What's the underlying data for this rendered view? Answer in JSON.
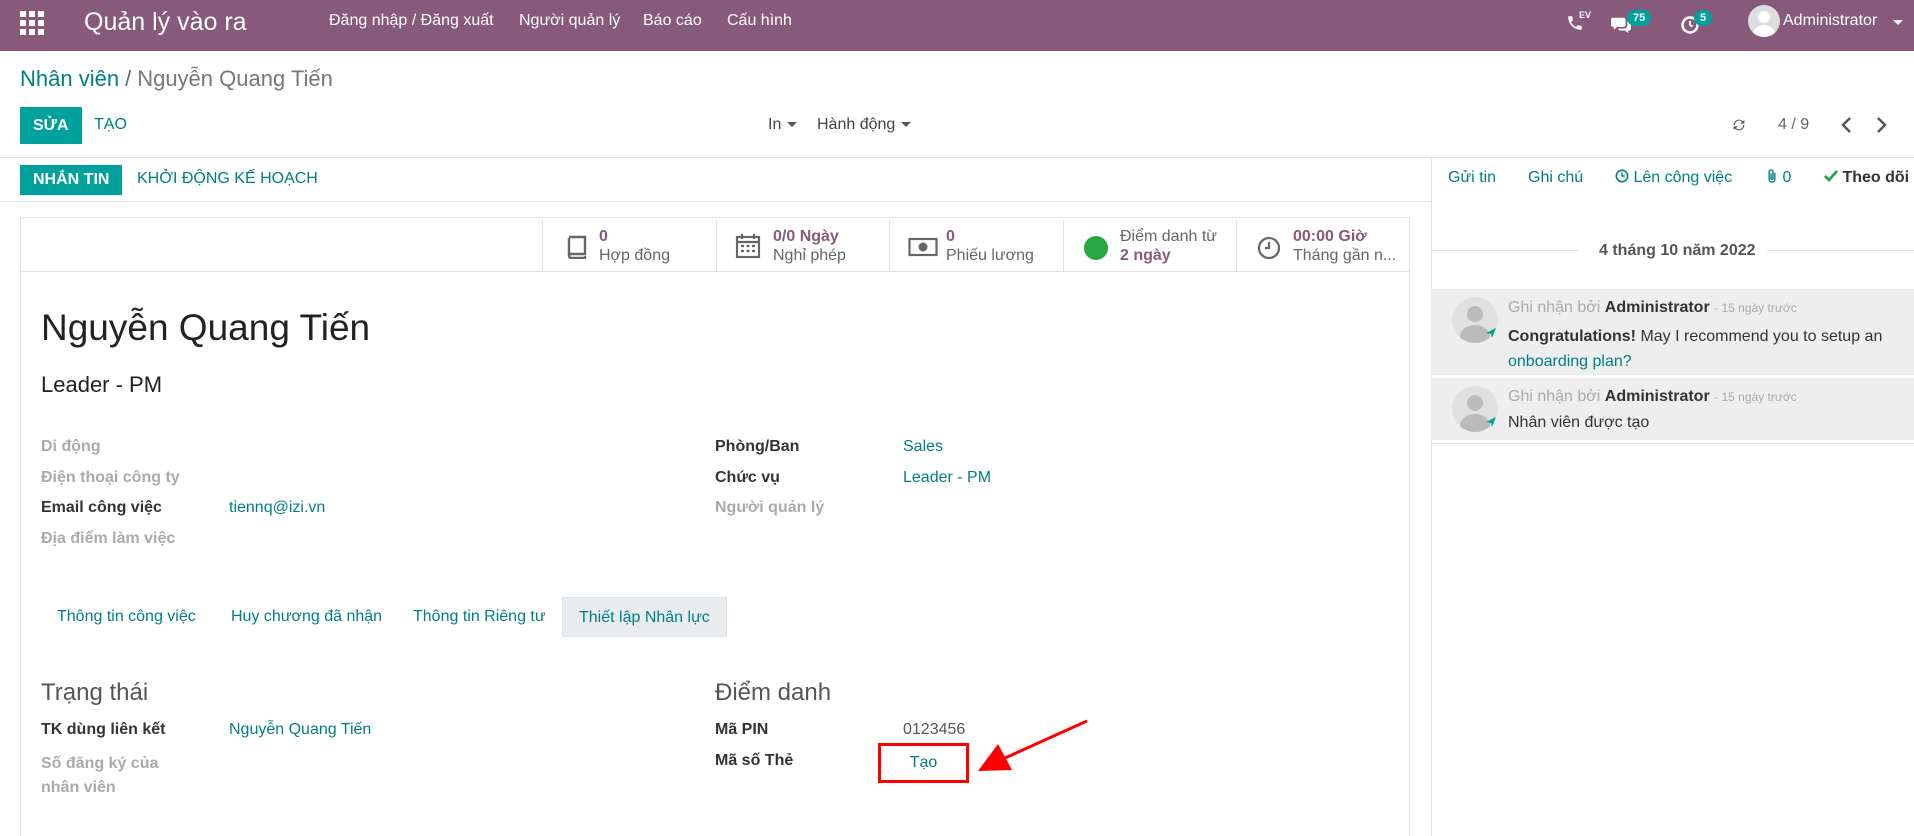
{
  "navbar": {
    "app_title": "Quản lý vào ra",
    "menu": [
      "Đăng nhập / Đăng xuất",
      "Người quản lý",
      "Báo cáo",
      "Cấu hình"
    ],
    "phone_label": "EV",
    "messages_count": "75",
    "activities_count": "5",
    "user": "Administrator"
  },
  "breadcrumb": {
    "parent": "Nhân viên",
    "separator": "/",
    "current": "Nguyễn Quang Tiến"
  },
  "toolbar": {
    "edit_label": "SỬA",
    "create_label": "TẠO",
    "print_label": "In",
    "action_label": "Hành động",
    "pager": "4 / 9"
  },
  "statusbar": {
    "send_message_label": "NHẮN TIN",
    "launch_plan_label": "KHỞI ĐỘNG KẾ HOẠCH"
  },
  "stat_buttons": [
    {
      "icon": "book-icon",
      "value": "0",
      "label": "Hợp đồng"
    },
    {
      "icon": "calendar-icon",
      "value": "0/0 Ngày",
      "label": "Nghỉ phép"
    },
    {
      "icon": "money-icon",
      "value": "0",
      "label": "Phiếu lương"
    },
    {
      "icon": "presence-dot-icon",
      "value": "2 ngày",
      "label": "Điểm danh từ"
    },
    {
      "icon": "clock-icon",
      "value": "00:00 Giờ",
      "label": "Tháng gần n..."
    }
  ],
  "employee": {
    "name": "Nguyễn Quang Tiến",
    "job_title": "Leader - PM"
  },
  "fields_left": [
    {
      "label": "Di động",
      "value": "",
      "required": false
    },
    {
      "label": "Điện thoại công ty",
      "value": "",
      "required": false
    },
    {
      "label": "Email công việc",
      "value": "tiennq@izi.vn",
      "required": true
    },
    {
      "label": "Địa điểm làm việc",
      "value": "",
      "required": false
    }
  ],
  "fields_right": [
    {
      "label": "Phòng/Ban",
      "value": "Sales",
      "required": true
    },
    {
      "label": "Chức vụ",
      "value": "Leader - PM",
      "required": true
    },
    {
      "label": "Người quản lý",
      "value": "",
      "required": false
    }
  ],
  "tabs": [
    "Thông tin công việc",
    "Huy chương đã nhận",
    "Thông tin Riêng tư",
    "Thiết lập Nhân lực"
  ],
  "status_section": {
    "title": "Trạng thái",
    "linked_user_label": "TK dùng liên kết",
    "linked_user_value": "Nguyễn Quang Tiến",
    "reg_number_label": "Số đăng ký của nhân viên"
  },
  "attendance_section": {
    "title": "Điểm danh",
    "pin_label": "Mã PIN",
    "pin_value": "0123456",
    "badge_label": "Mã số Thẻ",
    "badge_button": "Tạo"
  },
  "chatter": {
    "send_message": "Gửi tin",
    "log_note": "Ghi chú",
    "schedule_activity": "Lên công việc",
    "attachments_count": "0",
    "follow": "Theo dõi",
    "date_separator": "4 tháng 10 năm 2022",
    "messages": [
      {
        "prefix": "Ghi nhận bởi",
        "author": "Administrator",
        "time": "- 15 ngày trước",
        "bold": "Congratulations!",
        "text": " May I recommend you to setup an",
        "link": "onboarding plan?"
      },
      {
        "prefix": "Ghi nhận bởi",
        "author": "Administrator",
        "time": "- 15 ngày trước",
        "bold": "",
        "text": "Nhân viên được tạo",
        "link": ""
      }
    ]
  },
  "colors": {
    "navbar": "#875a7b",
    "primary": "#00a09d",
    "link": "#017e84",
    "highlight_annotation": "#ff0000"
  }
}
